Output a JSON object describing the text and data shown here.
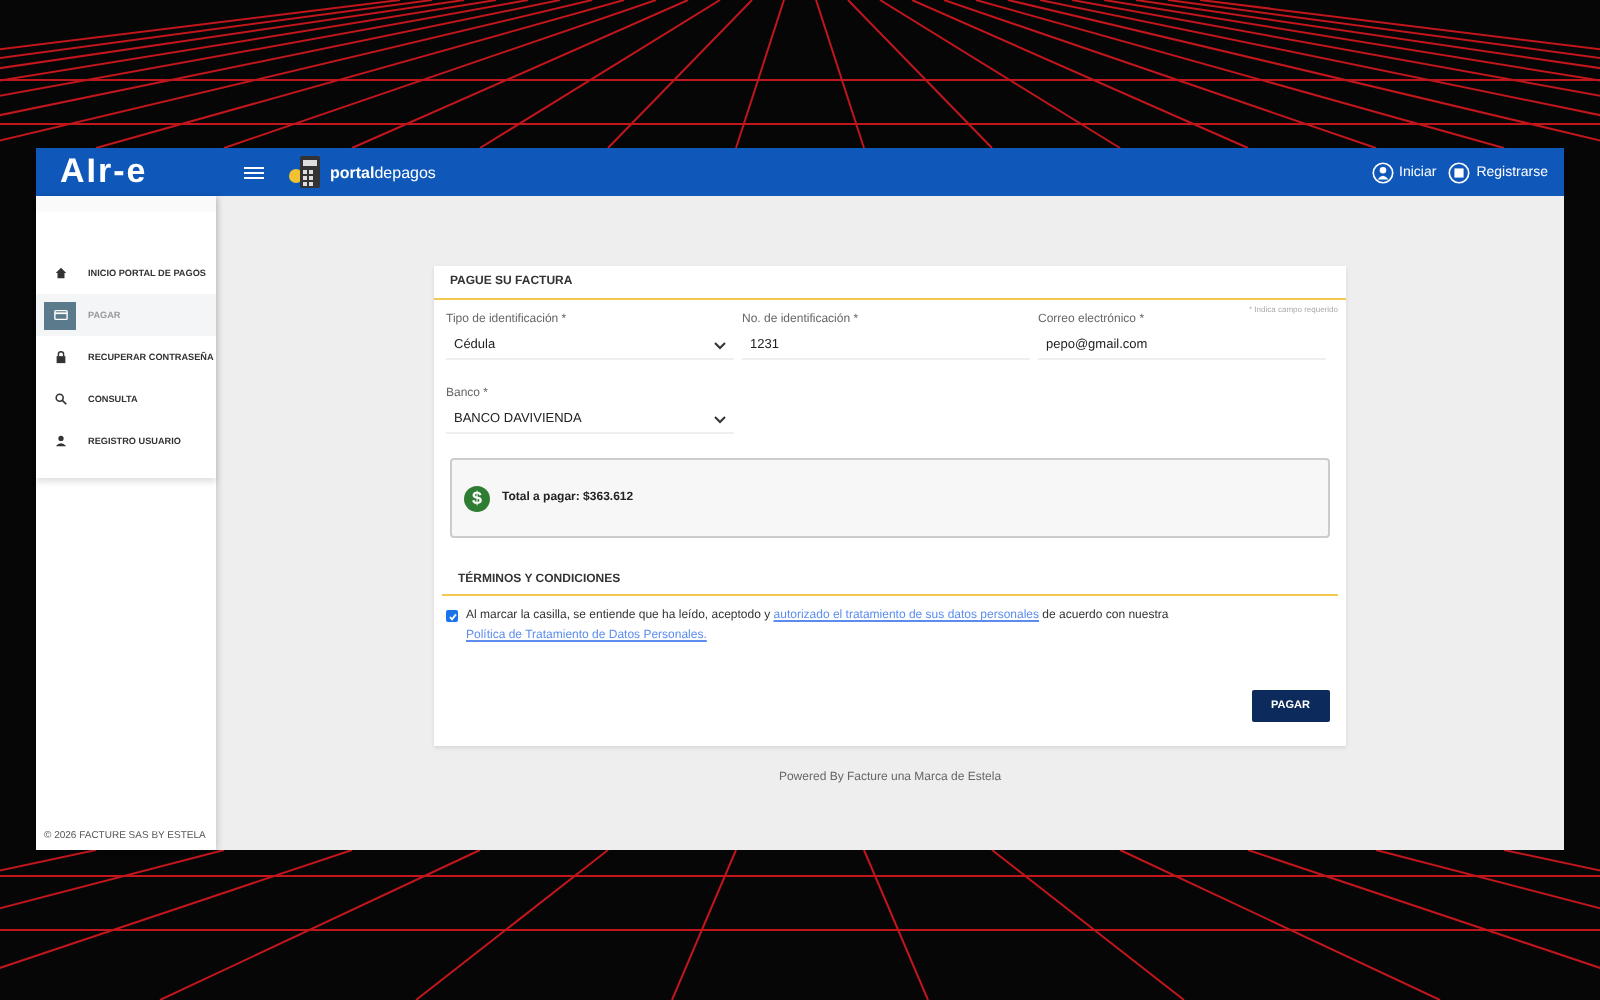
{
  "header": {
    "logo": "AIr-e",
    "portal_bold": "portal",
    "portal_rest": "depagos",
    "actions": [
      {
        "kind": "user",
        "label": "Iniciar"
      },
      {
        "kind": "register",
        "label": "Registrarse"
      }
    ]
  },
  "sidebar": {
    "items": [
      {
        "label": "INICIO PORTAL DE PAGOS",
        "selected": false
      },
      {
        "label": "PAGAR",
        "selected": true
      },
      {
        "label": "RECUPERAR CONTRASEÑA",
        "selected": false
      },
      {
        "label": "CONSULTA",
        "selected": false
      },
      {
        "label": "REGISTRO USUARIO",
        "selected": false
      }
    ],
    "footer": "© 2026 FACTURE SAS BY ESTELA"
  },
  "form": {
    "title": "PAGUE SU FACTURA",
    "required_note": "* Indica campo requerido",
    "fields": [
      {
        "kind": "select",
        "label": "Tipo de identificación *",
        "value": "Cédula"
      },
      {
        "kind": "text",
        "label": "No. de identificación *",
        "value": "1231"
      },
      {
        "kind": "text",
        "label": "Correo electrónico *",
        "value": "pepo@gmail.com"
      },
      {
        "kind": "select",
        "label": "Banco *",
        "value": "BANCO DAVIVIENDA"
      }
    ],
    "total_icon": "$",
    "total": "Total a pagar: $363.612",
    "terms_title": "TÉRMINOS Y CONDICIONES",
    "terms": {
      "checked": true,
      "text_1": "Al marcar la casilla, se entiende que ha leído, aceptodo y ",
      "link_1": "autorizado el tratamiento de sus datos personales",
      "text_2": " de acuerdo con nuestra ",
      "link_2": "Política de Tratamiento de Datos Personales."
    },
    "submit": "PAGAR"
  },
  "powered_by": "Powered By Facture una Marca de Estela"
}
